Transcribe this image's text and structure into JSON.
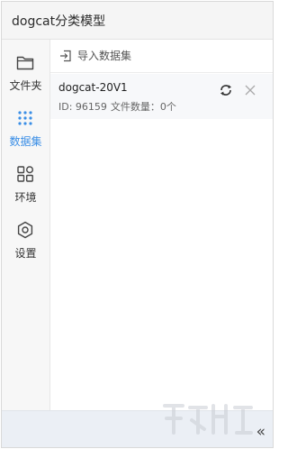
{
  "window": {
    "title": "dogcat分类模型"
  },
  "sidebar": {
    "items": [
      {
        "label": "文件夹",
        "icon": "folder-icon",
        "active": false
      },
      {
        "label": "数据集",
        "icon": "dataset-icon",
        "active": true
      },
      {
        "label": "环境",
        "icon": "environment-icon",
        "active": false
      },
      {
        "label": "设置",
        "icon": "settings-icon",
        "active": false
      }
    ]
  },
  "toolbar": {
    "import_label": "导入数据集",
    "import_icon": "import-icon"
  },
  "datasets": [
    {
      "name": "dogcat-20V1",
      "id_text": "ID: 96159",
      "file_count_text": "文件数量：0个",
      "actions": [
        "sync-icon",
        "close-icon"
      ]
    }
  ],
  "footer": {
    "collapse_label": "«",
    "collapse_icon": "double-chevron-left-icon"
  },
  "colors": {
    "accent": "#3a8ee6",
    "footer_bg": "#ebeff5",
    "card_bg": "#f7f8fa"
  }
}
